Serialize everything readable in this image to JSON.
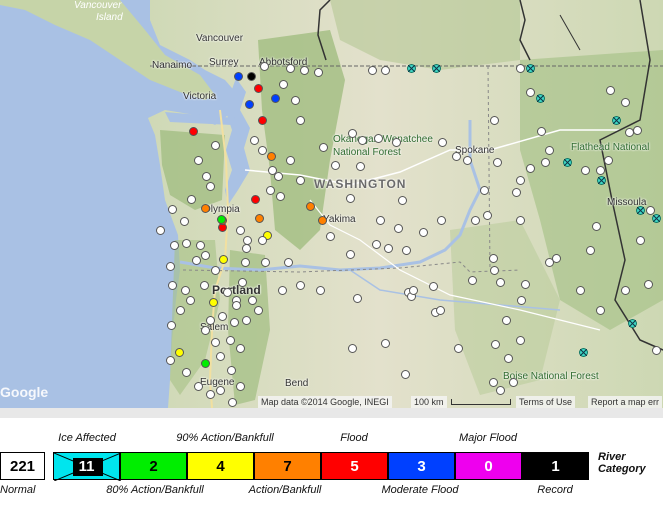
{
  "map": {
    "places": [
      {
        "name": "Vancouver",
        "type": "city"
      },
      {
        "name": "Nanaimo",
        "type": "city"
      },
      {
        "name": "Surrey",
        "type": "city"
      },
      {
        "name": "Abbotsford",
        "type": "city"
      },
      {
        "name": "Victoria",
        "type": "city"
      },
      {
        "name": "Olympia",
        "type": "city"
      },
      {
        "name": "Yakima",
        "type": "city"
      },
      {
        "name": "Spokane",
        "type": "city"
      },
      {
        "name": "Portland",
        "type": "city"
      },
      {
        "name": "Salem",
        "type": "city"
      },
      {
        "name": "Eugene",
        "type": "city"
      },
      {
        "name": "Bend",
        "type": "city"
      },
      {
        "name": "Missoula",
        "type": "city"
      },
      {
        "name": "WASHINGTON",
        "type": "state"
      },
      {
        "name": "Okanogan-Wenatchee",
        "type": "forest"
      },
      {
        "name": "National Forest",
        "type": "forest"
      },
      {
        "name": "Flathead National",
        "type": "forest"
      },
      {
        "name": "Boise National Forest",
        "type": "forest"
      },
      {
        "name": "Vancouver",
        "type": "island"
      },
      {
        "name": "Island",
        "type": "island"
      }
    ],
    "logo_text": "Google",
    "attribution": "Map data ©2014 Google, INEGI",
    "scale_label": "100 km",
    "terms": "Terms of Use",
    "report": "Report a map err"
  },
  "legend": {
    "title": "River Category",
    "categories": [
      {
        "name": "Normal",
        "count": "221",
        "color": "#ffffff",
        "text_color": "#000000"
      },
      {
        "name": "Ice Affected",
        "count": "11",
        "color": "#00e5ee",
        "text_color": "#ffffff"
      },
      {
        "name": "80% Action/Bankfull",
        "count": "2",
        "color": "#00ee00",
        "text_color": "#000000"
      },
      {
        "name": "90% Action/Bankfull",
        "count": "4",
        "color": "#ffff00",
        "text_color": "#000000"
      },
      {
        "name": "Action/Bankfull",
        "count": "7",
        "color": "#ff8000",
        "text_color": "#000000"
      },
      {
        "name": "Flood",
        "count": "5",
        "color": "#ff0000",
        "text_color": "#ffffff"
      },
      {
        "name": "Moderate Flood",
        "count": "3",
        "color": "#0040ff",
        "text_color": "#ffffff"
      },
      {
        "name": "Major Flood",
        "count": "0",
        "color": "#ee00ee",
        "text_color": "#ffffff"
      },
      {
        "name": "Record",
        "count": "1",
        "color": "#000000",
        "text_color": "#ffffff"
      }
    ]
  }
}
